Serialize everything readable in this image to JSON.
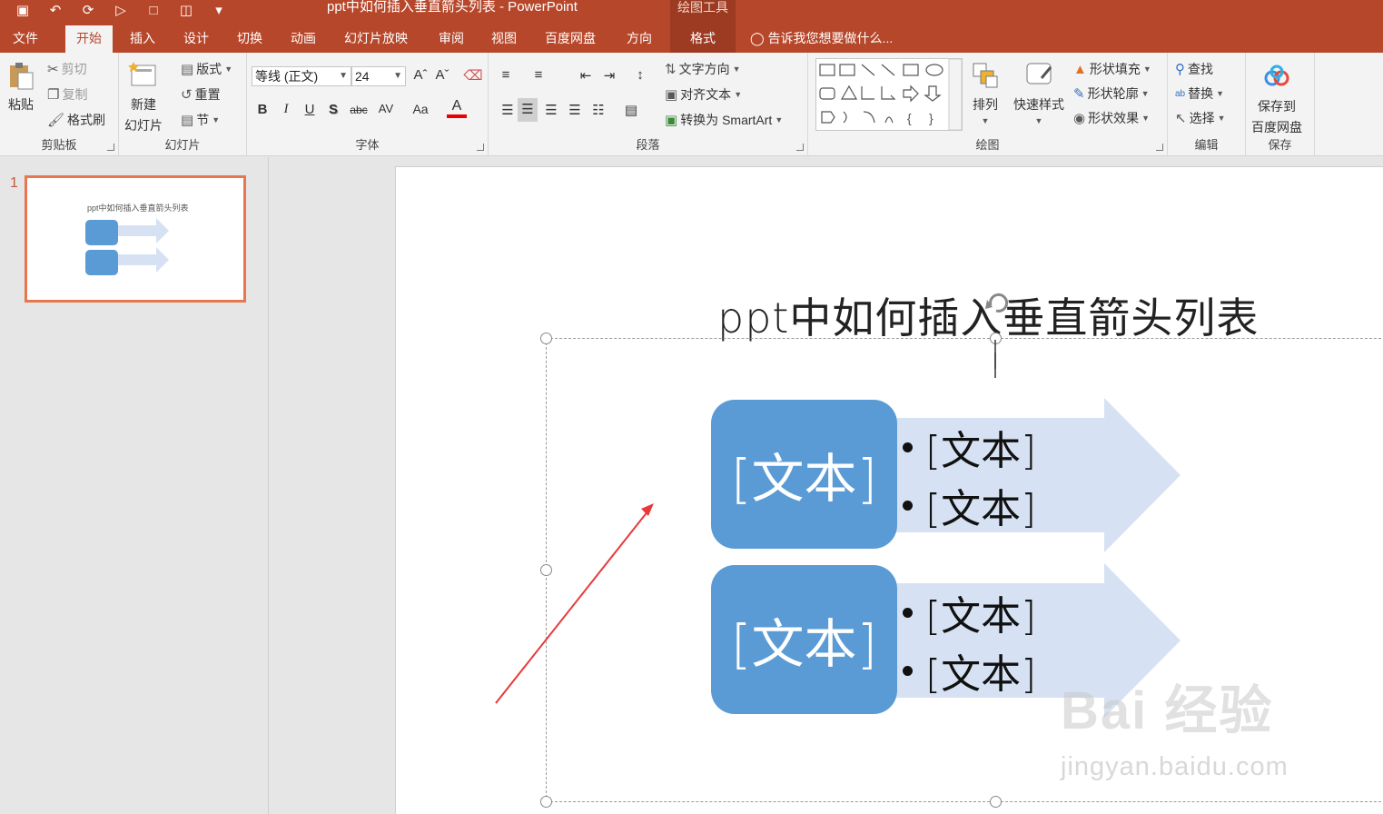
{
  "window": {
    "title": "ppt中如何插入垂直箭头列表 - PowerPoint",
    "context_group": "绘图工具"
  },
  "qat": {
    "icons": [
      "save-icon",
      "undo-icon",
      "redo-icon",
      "present-icon",
      "comment-icon",
      "layout-icon",
      "customize-icon"
    ]
  },
  "tabs": [
    {
      "label": "文件"
    },
    {
      "label": "开始"
    },
    {
      "label": "插入"
    },
    {
      "label": "设计"
    },
    {
      "label": "切换"
    },
    {
      "label": "动画"
    },
    {
      "label": "幻灯片放映"
    },
    {
      "label": "审阅"
    },
    {
      "label": "视图"
    },
    {
      "label": "百度网盘"
    },
    {
      "label": "方向"
    },
    {
      "label": "格式"
    }
  ],
  "tell_me": "告诉我您想要做什么...",
  "ribbon": {
    "clipboard": {
      "paste": "粘贴",
      "cut": "剪切",
      "copy": "复制",
      "format_painter": "格式刷",
      "label": "剪贴板"
    },
    "slides": {
      "new_slide_1": "新建",
      "new_slide_2": "幻灯片",
      "layout": "版式",
      "reset": "重置",
      "section": "节",
      "label": "幻灯片"
    },
    "font": {
      "font_name": "等线 (正文)",
      "font_size": "24",
      "bold": "B",
      "italic": "I",
      "underline": "U",
      "shadow": "S",
      "strike": "abc",
      "spacing": "AV",
      "case": "Aa",
      "label": "字体"
    },
    "paragraph": {
      "text_direction": "文字方向",
      "align_text": "对齐文本",
      "smartart": "转换为 SmartArt",
      "label": "段落"
    },
    "drawing": {
      "arrange": "排列",
      "quick_styles": "快速样式",
      "shape_fill": "形状填充",
      "shape_outline": "形状轮廓",
      "shape_effects": "形状效果",
      "label": "绘图"
    },
    "editing": {
      "find": "查找",
      "replace": "替换",
      "select": "选择",
      "label": "编辑"
    },
    "save": {
      "save_1": "保存到",
      "save_2": "百度网盘",
      "label": "保存"
    }
  },
  "thumbnail": {
    "number": "1",
    "title": "ppt中如何插入垂直箭头列表"
  },
  "slide": {
    "title": "ppt中如何插入垂直箭头列表",
    "items": [
      {
        "level1": "[文本]",
        "bullets": [
          "[文本]",
          "[文本]"
        ]
      },
      {
        "level1": "[文本]",
        "bullets": [
          "[文本]",
          "[文本]"
        ]
      }
    ]
  },
  "colors": {
    "accent": "#b7472a",
    "shape_blue": "#5b9bd5",
    "arrow_light": "#d6e2f3",
    "annotation_red": "#e8383a"
  },
  "watermark": {
    "brand": "Bai  经验",
    "url": "jingyan.baidu.com"
  }
}
